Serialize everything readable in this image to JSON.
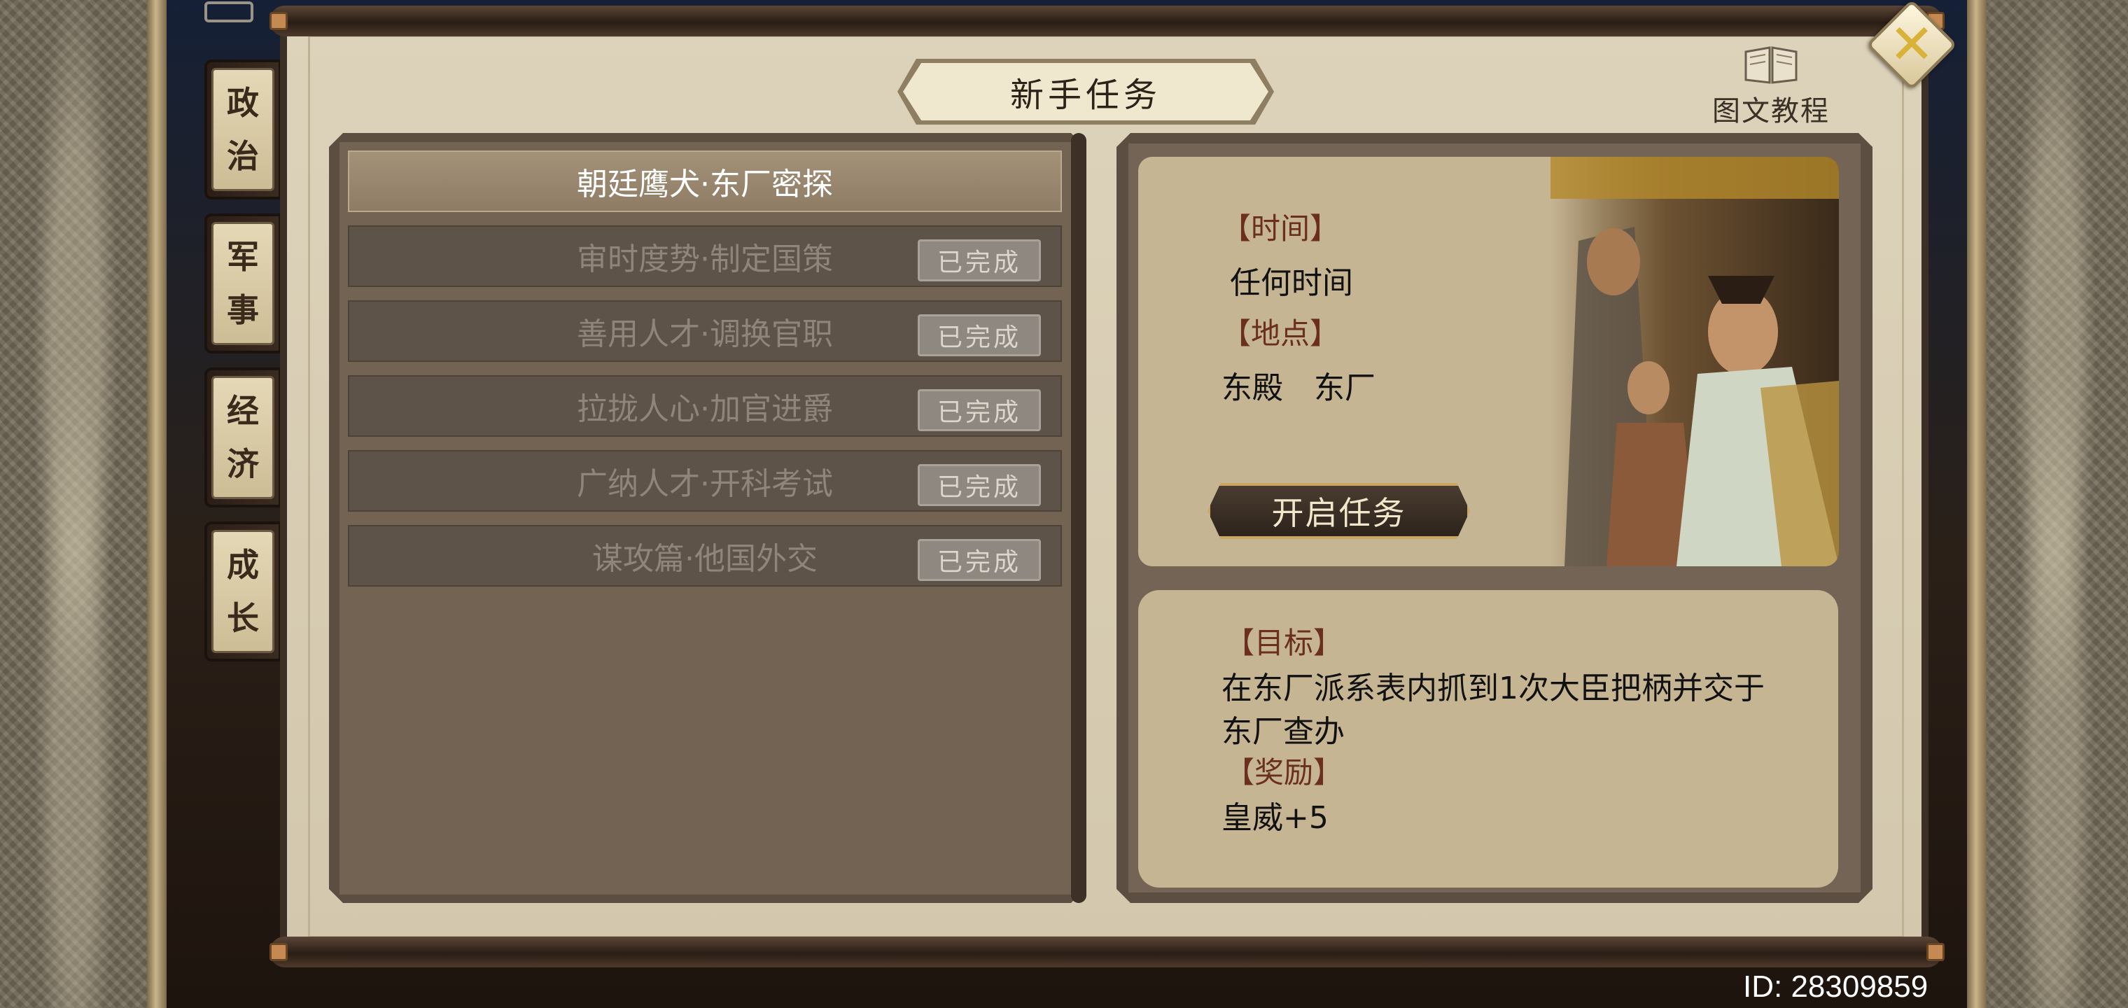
{
  "title": "新手任务",
  "tutorial": {
    "label": "图文教程"
  },
  "sidebar": {
    "tabs": [
      {
        "label_top": "政",
        "label_bottom": "治"
      },
      {
        "label_top": "军",
        "label_bottom": "事"
      },
      {
        "label_top": "经",
        "label_bottom": "济"
      },
      {
        "label_top": "成",
        "label_bottom": "长"
      }
    ]
  },
  "tasks": [
    {
      "name": "朝廷鹰犬·东厂密探",
      "status": ""
    },
    {
      "name": "审时度势·制定国策",
      "status": "已完成"
    },
    {
      "name": "善用人才·调换官职",
      "status": "已完成"
    },
    {
      "name": "拉拢人心·加官进爵",
      "status": "已完成"
    },
    {
      "name": "广纳人才·开科考试",
      "status": "已完成"
    },
    {
      "name": "谋攻篇·他国外交",
      "status": "已完成"
    }
  ],
  "detail": {
    "time_label": "【时间】",
    "time_value": "任何时间",
    "place_label": "【地点】",
    "place_value": "东殿　东厂",
    "start_button": "开启任务",
    "goal_label": "【目标】",
    "goal_line1": "在东厂派系表内抓到1次大臣把柄并交于",
    "goal_line2": "东厂查办",
    "reward_label": "【奖励】",
    "reward_value": "皇威+5"
  },
  "footer": {
    "id_text": "ID: 28309859"
  },
  "colors": {
    "accent_gold": "#d9b23a",
    "label_red": "#6a2f1f",
    "panel_brown": "#5c4e40"
  },
  "icons": {
    "close": "close-x-icon",
    "tutorial": "book-icon"
  }
}
